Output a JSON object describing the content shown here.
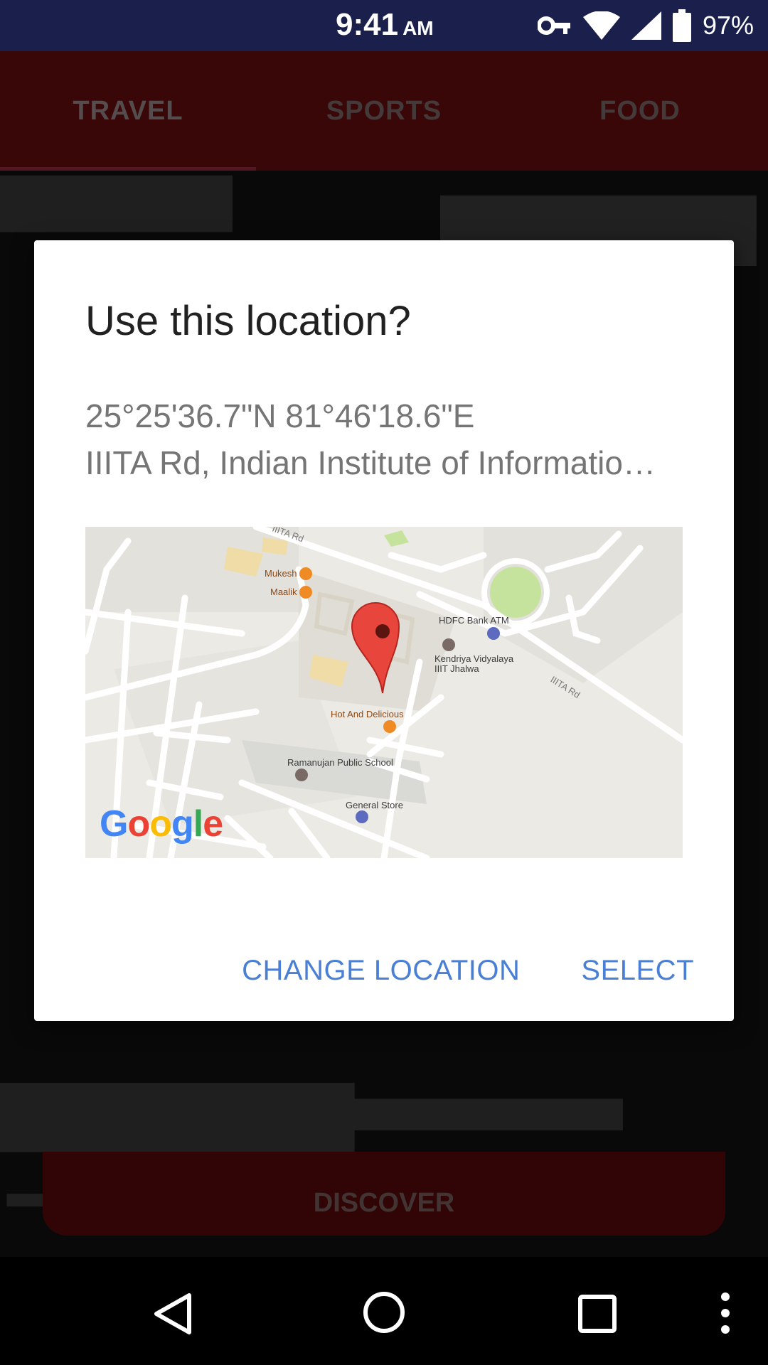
{
  "status_bar": {
    "time": "9:41",
    "ampm": "AM",
    "battery_percent": "97%",
    "icons": [
      "vpn-key-icon",
      "wifi-icon",
      "signal-icon",
      "battery-icon"
    ]
  },
  "tabs": [
    {
      "label": "TRAVEL",
      "active": true
    },
    {
      "label": "SPORTS",
      "active": false
    },
    {
      "label": "FOOD",
      "active": false
    }
  ],
  "background": {
    "discover_label": "DISCOVER"
  },
  "dialog": {
    "title": "Use this location?",
    "coordinates": "25°25'36.7\"N 81°46'18.6\"E",
    "address": "IIITA Rd, Indian Institute of Informatio…",
    "map": {
      "places": {
        "mukesh": "Mukesh",
        "maalik": "Maalik",
        "hdfc": "HDFC Bank ATM",
        "kendriya_1": "Kendriya Vidyalaya",
        "kendriya_2": "IIIT Jhalwa",
        "hot": "Hot And Delicious",
        "ramanujan": "Ramanujan Public School",
        "general": "General Store",
        "road_1": "IIITA Rd",
        "road_2": "IIITA Rd"
      },
      "logo": {
        "g": "G",
        "o1": "o",
        "o2": "o",
        "g2": "g",
        "l": "l",
        "e": "e"
      }
    },
    "actions": {
      "change_location": "CHANGE LOCATION",
      "select": "SELECT"
    }
  },
  "colors": {
    "status_bar": "#1a1f4b",
    "tab_bar": "#6a0d0f",
    "accent": "#4a7fd6"
  }
}
